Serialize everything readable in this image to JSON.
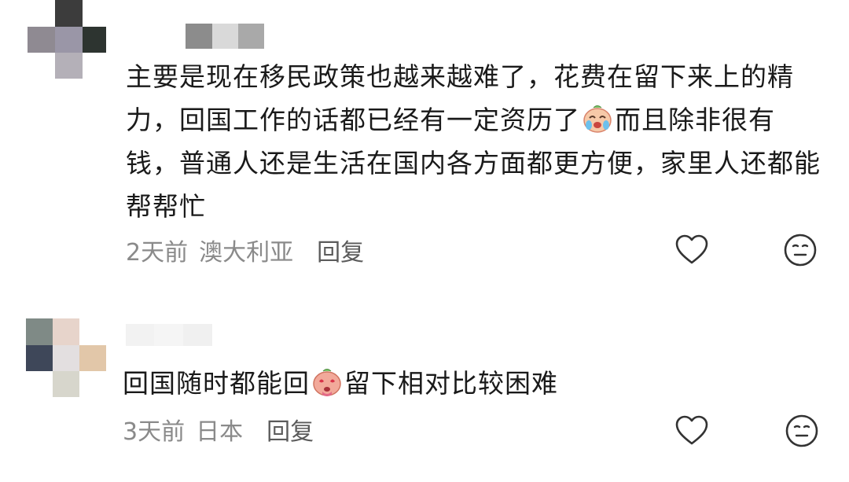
{
  "comments": [
    {
      "avatar_colors": [
        "#ffffff",
        "#3c3c3c",
        "#ffffff",
        "#8f8a92",
        "#9a96a7",
        "#2d3430",
        "#ffffff",
        "#b4b0b8",
        "#ffffff"
      ],
      "username_blur_colors": [
        "#8c8c8c",
        "#d9d9d9",
        "#a9a9a9"
      ],
      "text_parts": [
        "主要是现在移民政策也越来越难了，花费在留下来上的精力，回国工作的话都已经有一定资历了",
        "而且除非很有钱，普通人还是生活在国内各方面都更方便，家里人还都能帮帮忙"
      ],
      "emoji": "crying-face-emoji",
      "time": "2天前",
      "location": "澳大利亚",
      "reply_label": "回复"
    },
    {
      "avatar_colors": [
        "#7f8a86",
        "#e7d4cb",
        "#ffffff",
        "#3e4759",
        "#e3dfe0",
        "#e2c7a9",
        "#ffffff",
        "#d7d6cc",
        "#ffffff"
      ],
      "username_blur_colors": [
        "#f2f2f2",
        "#f5f5f5",
        "#f0f0f0"
      ],
      "text_parts": [
        "回国随时都能回",
        "留下相对比较困难"
      ],
      "emoji": "heart-eyes-face-emoji",
      "time": "3天前",
      "location": "日本",
      "reply_label": "回复"
    }
  ],
  "icons": {
    "like": "heart-outline-icon",
    "dislike": "expressionless-face-icon"
  },
  "colors": {
    "text": "#1a1a1a",
    "meta": "#8a8a8a",
    "icon": "#333333"
  }
}
